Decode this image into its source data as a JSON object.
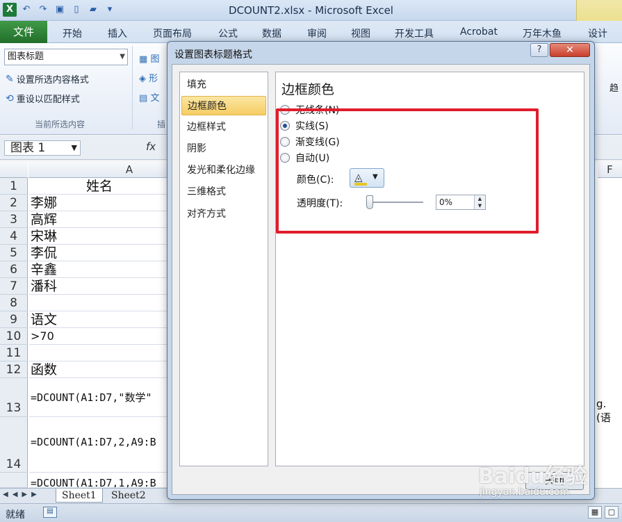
{
  "window": {
    "title": "DCOUNT2.xlsx - Microsoft Excel",
    "logo": "X"
  },
  "ribbon_tabs": {
    "file": "文件",
    "items": [
      "开始",
      "插入",
      "页面布局",
      "公式",
      "数据",
      "审阅",
      "视图",
      "开发工具",
      "Acrobat",
      "万年木鱼",
      "设计"
    ]
  },
  "ribbon": {
    "chart_element": "图表标题",
    "format_selection": "设置所选内容格式",
    "reset_style": "重设以匹配样式",
    "group_current": "当前所选内容",
    "partial_1": "图",
    "partial_2": "形",
    "partial_3": "文",
    "partial_group": "插",
    "right_partial": "趋"
  },
  "formula_bar": {
    "name_box": "图表 1",
    "fx": "fx"
  },
  "grid": {
    "columns": [
      "A",
      "F"
    ],
    "rows": [
      {
        "num": "1",
        "a": "姓名"
      },
      {
        "num": "2",
        "a": "李娜"
      },
      {
        "num": "3",
        "a": "高辉"
      },
      {
        "num": "4",
        "a": "宋琳"
      },
      {
        "num": "5",
        "a": "李侃"
      },
      {
        "num": "6",
        "a": "辛鑫"
      },
      {
        "num": "7",
        "a": "潘科"
      },
      {
        "num": "8",
        "a": ""
      },
      {
        "num": "9",
        "a": "语文"
      },
      {
        "num": "10",
        "a": ">70"
      },
      {
        "num": "11",
        "a": ""
      },
      {
        "num": "12",
        "a": "函数"
      },
      {
        "num": "13",
        "a": "=DCOUNT(A1:D7,\"数学\""
      },
      {
        "num": "14",
        "a": "=DCOUNT(A1:D7,2,A9:B"
      },
      {
        "num": "",
        "a": "=DCOUNT(A1:D7,1,A9:B"
      }
    ],
    "right_overflow": "g. (语"
  },
  "sheets": [
    "Sheet1",
    "Sheet2"
  ],
  "status": {
    "ready": "就绪"
  },
  "dialog": {
    "title": "设置图表标题格式",
    "help": "?",
    "close_x": "✕",
    "nav": [
      "填充",
      "边框颜色",
      "边框样式",
      "阴影",
      "发光和柔化边缘",
      "三维格式",
      "对齐方式"
    ],
    "selected_nav": "边框颜色",
    "section_title": "边框颜色",
    "options": [
      {
        "label": "无线条(N)",
        "checked": false
      },
      {
        "label": "实线(S)",
        "checked": true
      },
      {
        "label": "渐变线(G)",
        "checked": false
      },
      {
        "label": "自动(U)",
        "checked": false
      }
    ],
    "color_label": "颜色(C):",
    "transparency_label": "透明度(T):",
    "transparency_value": "0%",
    "close_button": "关闭"
  },
  "watermark": {
    "brand": "Baidu经验",
    "url": "jingyan.baidu.com"
  },
  "colors": {
    "accent": "#e01d2c",
    "file_tab": "#2a7a32",
    "selected_nav": "#f6cd63"
  }
}
